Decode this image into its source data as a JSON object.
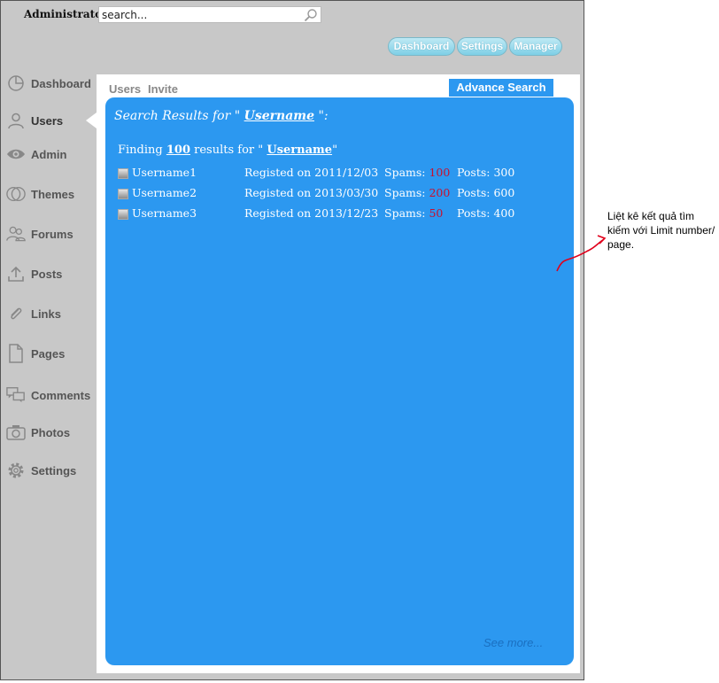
{
  "header": {
    "admin_label": "Administrator",
    "search_placeholder": "search..."
  },
  "top_buttons": [
    "Dashboard",
    "Settings",
    "Manager"
  ],
  "sidebar": {
    "items": [
      {
        "label": "Dashboard",
        "icon": "pie-chart-icon"
      },
      {
        "label": "Users",
        "icon": "user-icon"
      },
      {
        "label": "Admin",
        "icon": "eye-icon"
      },
      {
        "label": "Themes",
        "icon": "circles-icon"
      },
      {
        "label": "Forums",
        "icon": "users-group-icon"
      },
      {
        "label": "Posts",
        "icon": "upload-icon"
      },
      {
        "label": "Links",
        "icon": "paperclip-icon"
      },
      {
        "label": "Pages",
        "icon": "page-icon"
      },
      {
        "label": "Comments",
        "icon": "comments-icon"
      },
      {
        "label": "Photos",
        "icon": "camera-icon"
      },
      {
        "label": "Settings",
        "icon": "gear-icon"
      }
    ],
    "active": "Users"
  },
  "tabs": [
    "Users",
    "Invite"
  ],
  "advance_search_label": "Advance Search",
  "results": {
    "title_prefix": "Search Results for \" ",
    "title_term": "Username",
    "title_suffix": " \":",
    "finding_prefix": "Finding ",
    "finding_count": "100",
    "finding_mid": "  results for \" ",
    "finding_term": "Username",
    "finding_suffix": "\"",
    "rows": [
      {
        "username": "Username1",
        "registered": "Registed on 2011/12/03",
        "spams_label": "Spams: ",
        "spams": "100",
        "posts": "Posts: 300"
      },
      {
        "username": "Username2",
        "registered": "Registed on 2013/03/30",
        "spams_label": "Spams: ",
        "spams": "200",
        "posts": "Posts: 600"
      },
      {
        "username": "Username3",
        "registered": "Registed on 2013/12/23",
        "spams_label": "Spams: ",
        "spams": "50",
        "posts": "Posts: 400"
      }
    ],
    "see_more": "See more..."
  },
  "annotation": "Liệt kê kết quả tìm kiếm với Limit number/ page.",
  "colors": {
    "accent": "#2c98f0",
    "frame_bg": "#c8c8c8",
    "spam_red": "#c8102e",
    "arrow_red": "#e0001b"
  }
}
